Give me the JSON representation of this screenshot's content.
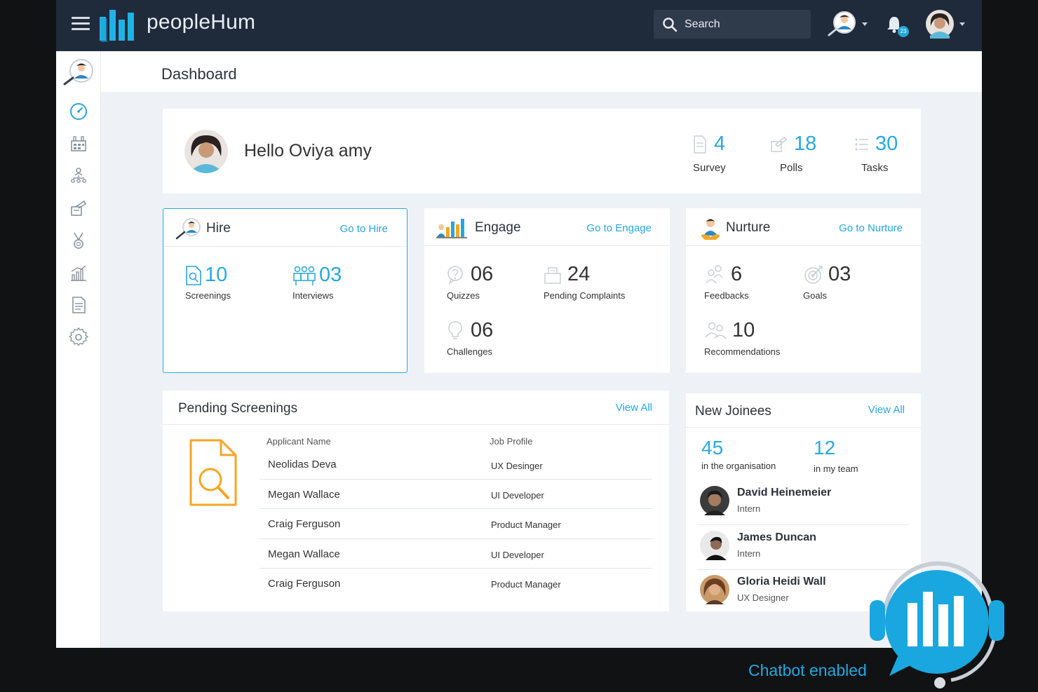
{
  "app": {
    "brand": "peopleHum"
  },
  "search": {
    "placeholder": "Search"
  },
  "notifications": {
    "count": "23"
  },
  "page": {
    "title": "Dashboard"
  },
  "greeting": {
    "text": "Hello Oviya amy",
    "stats": [
      {
        "value": "4",
        "label": "Survey"
      },
      {
        "value": "18",
        "label": "Polls"
      },
      {
        "value": "30",
        "label": "Tasks"
      }
    ]
  },
  "hire": {
    "title": "Hire",
    "link": "Go to Hire",
    "stats": [
      {
        "value": "10",
        "label": "Screenings"
      },
      {
        "value": "03",
        "label": "Interviews"
      }
    ]
  },
  "engage": {
    "title": "Engage",
    "link": "Go to Engage",
    "stats": [
      {
        "value": "06",
        "label": "Quizzes"
      },
      {
        "value": "24",
        "label": "Pending Complaints"
      },
      {
        "value": "06",
        "label": "Challenges"
      }
    ]
  },
  "nurture": {
    "title": "Nurture",
    "link": "Go to Nurture",
    "stats": [
      {
        "value": "6",
        "label": "Feedbacks"
      },
      {
        "value": "03",
        "label": "Goals"
      },
      {
        "value": "10",
        "label": "Recommendations"
      }
    ]
  },
  "screenings": {
    "title": "Pending Screenings",
    "link": "View All",
    "headers": [
      "Applicant Name",
      "Job Profile"
    ],
    "rows": [
      {
        "name": "Neolidas Deva",
        "role": "UX Desinger"
      },
      {
        "name": "Megan Wallace",
        "role": "UI Developer"
      },
      {
        "name": "Craig Ferguson",
        "role": "Product Manager"
      },
      {
        "name": "Megan Wallace",
        "role": "UI Developer"
      },
      {
        "name": "Craig Ferguson",
        "role": "Product Manager"
      }
    ]
  },
  "joinees": {
    "title": "New Joinees",
    "link": "View All",
    "org_count": "45",
    "org_label": "in the organisation",
    "team_count": "12",
    "team_label": "in my team",
    "people": [
      {
        "name": "David Heinemeier",
        "role": "Intern"
      },
      {
        "name": "James Duncan",
        "role": "Intern"
      },
      {
        "name": "Gloria Heidi Wall",
        "role": "UX Designer"
      }
    ]
  },
  "chatbot": {
    "label": "Chatbot enabled"
  },
  "colors": {
    "topbar": "#1f2a3b",
    "accent": "#26a6dc",
    "background": "#eef1f5",
    "orange": "#f5a623"
  }
}
